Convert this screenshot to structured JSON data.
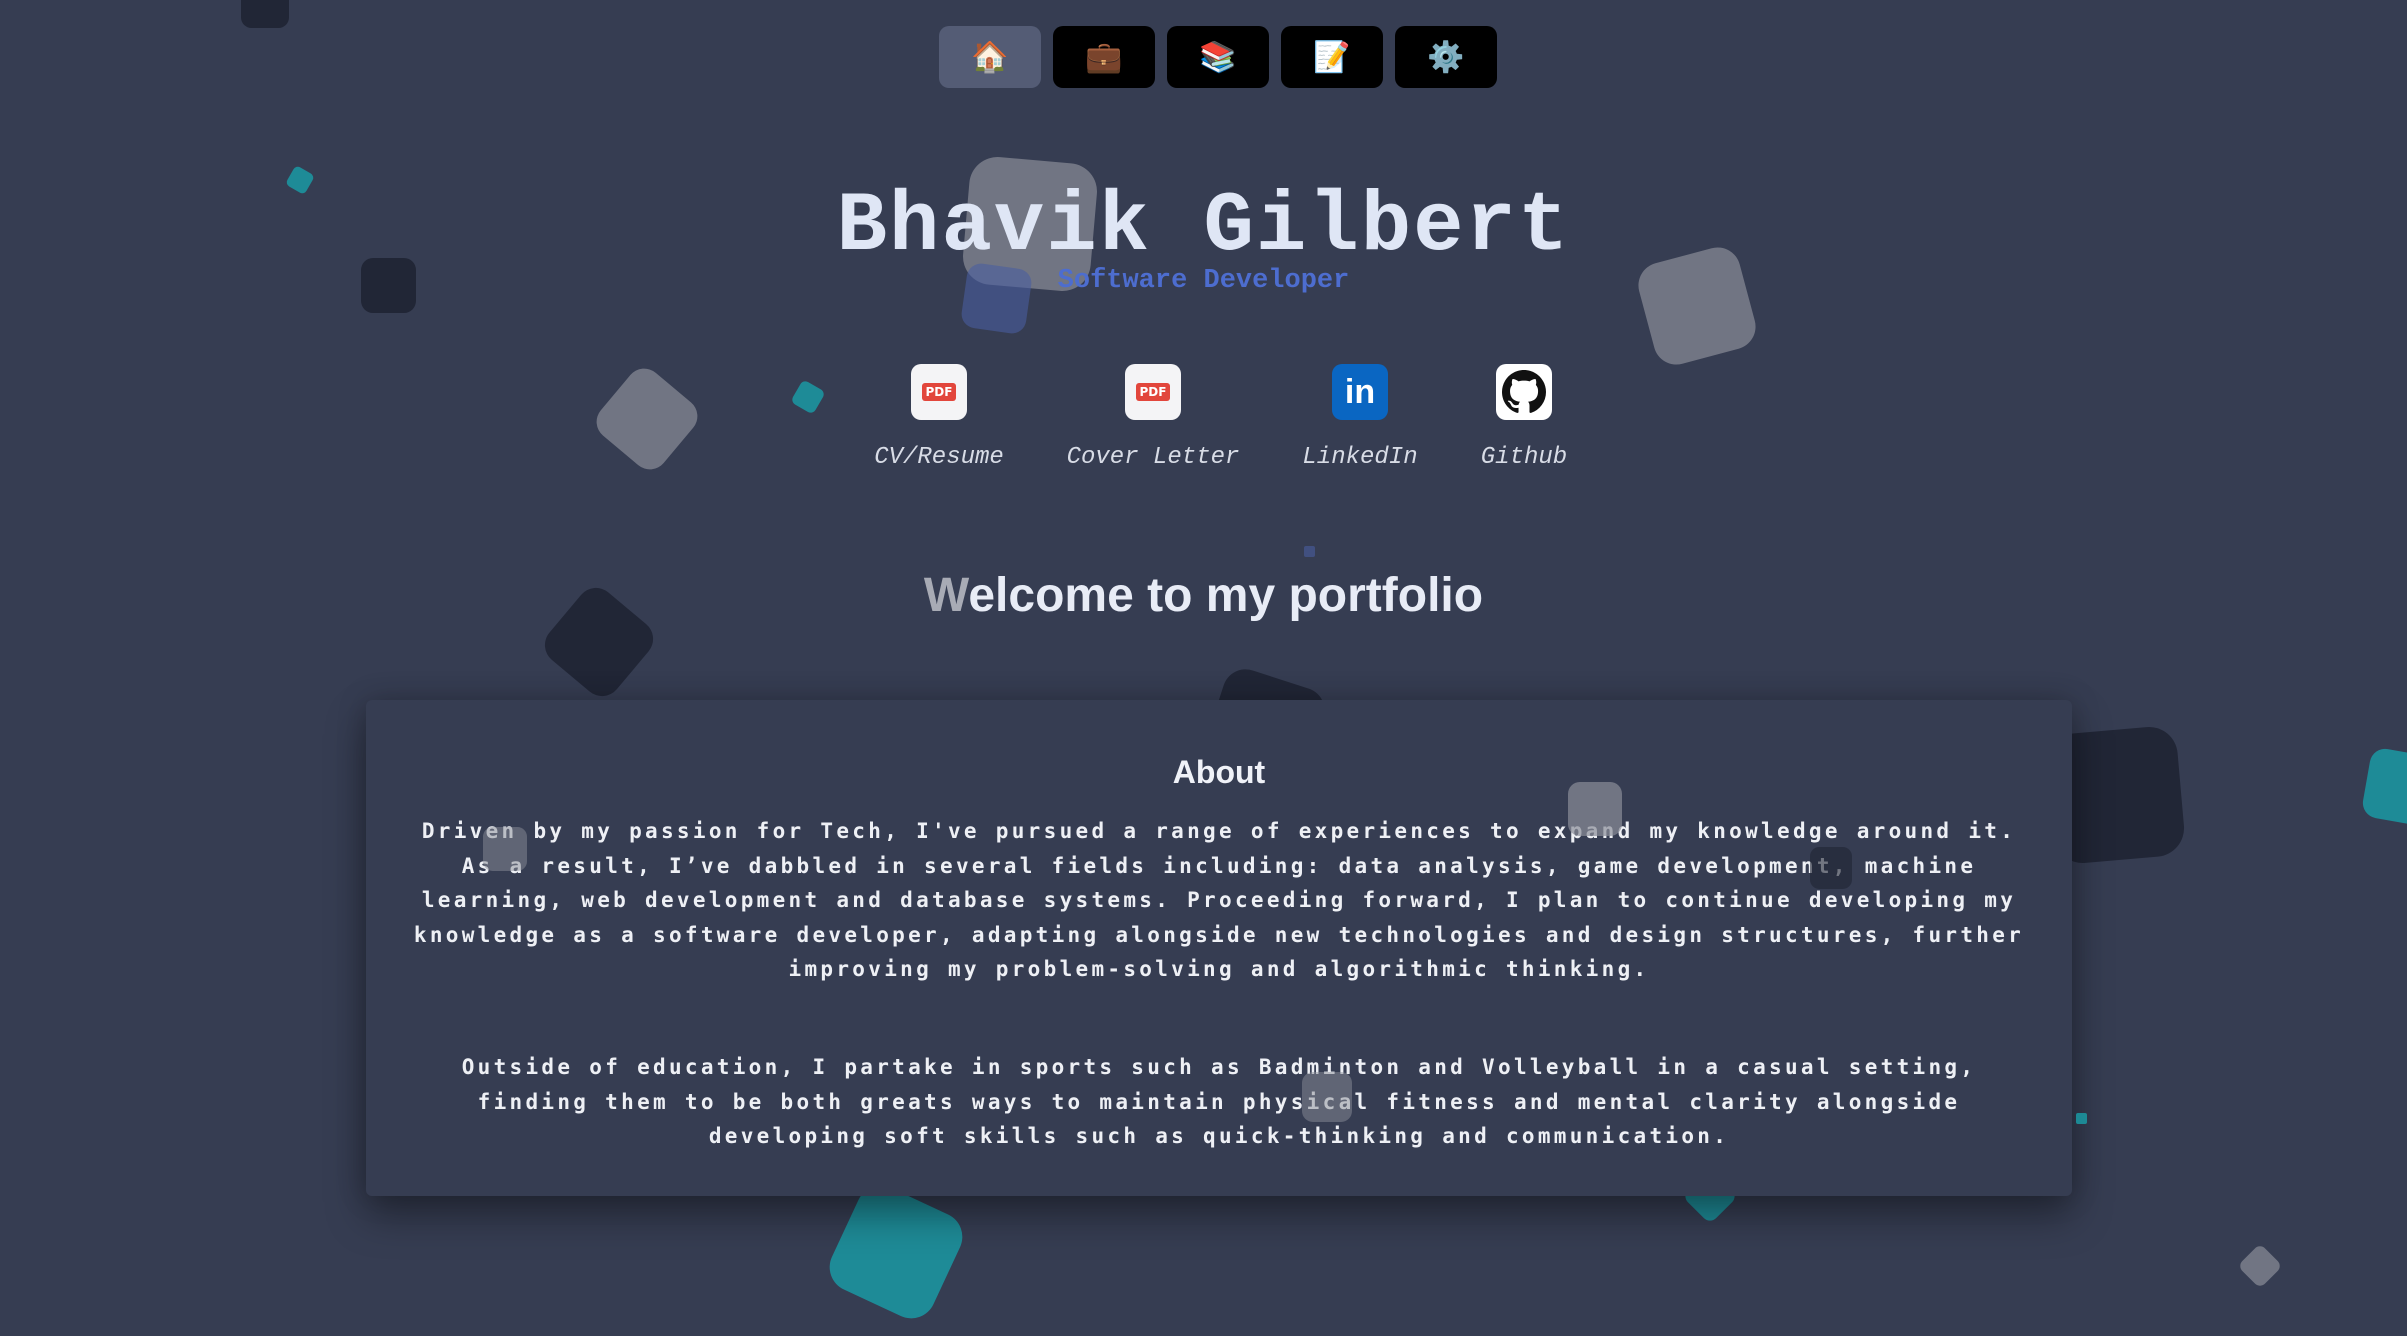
{
  "nav": {
    "items": [
      {
        "icon": "house-icon",
        "glyph": "🏠",
        "active": true
      },
      {
        "icon": "briefcase-icon",
        "glyph": "💼",
        "active": false
      },
      {
        "icon": "books-icon",
        "glyph": "📚",
        "active": false
      },
      {
        "icon": "memo-icon",
        "glyph": "📝",
        "active": false
      },
      {
        "icon": "gear-icon",
        "glyph": "⚙️",
        "active": false
      }
    ]
  },
  "header": {
    "name": "Bhavik Gilbert",
    "role": "Software Developer"
  },
  "links": [
    {
      "label": "CV/Resume",
      "icon": "pdf-icon",
      "badge": "PDF"
    },
    {
      "label": "Cover Letter",
      "icon": "pdf-icon",
      "badge": "PDF"
    },
    {
      "label": "LinkedIn",
      "icon": "linkedin-icon",
      "badge": "in"
    },
    {
      "label": "Github",
      "icon": "github-icon",
      "badge": ""
    }
  ],
  "welcome": {
    "first_letter": "W",
    "rest": "elcome to my portfolio"
  },
  "about": {
    "title": "About",
    "paragraph1": "Driven by my passion for Tech, I've pursued a range of experiences to expand my knowledge around it. As a result, I’ve dabbled in several fields including: data analysis, game development, machine learning, web development and database systems. Proceeding forward, I plan to continue developing my knowledge as a software developer, adapting alongside new technologies and design structures, further improving my problem-solving and algorithmic thinking.",
    "paragraph2": "Outside of education, I partake in sports such as Badminton and Volleyball in a casual setting, finding them to be both greats ways to maintain physical fitness and mental clarity alongside developing soft skills such as quick-thinking and communication."
  },
  "colors": {
    "background": "#363d52",
    "role": "#4d6dcf",
    "teal_shape": "#1a99a3",
    "nav_active": "#545c75"
  }
}
